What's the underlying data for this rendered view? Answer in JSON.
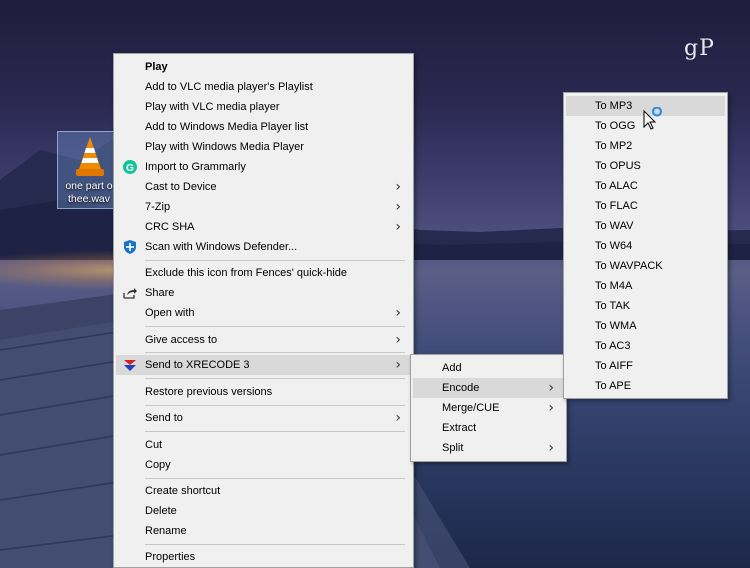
{
  "watermark": "gP",
  "desktop_icon": {
    "label_line1": "one part o",
    "label_line2": "thee.wav"
  },
  "main_menu": {
    "play": "Play",
    "add_vlc_playlist": "Add to VLC media player's Playlist",
    "play_vlc": "Play with VLC media player",
    "add_wmp_list": "Add to Windows Media Player list",
    "play_wmp": "Play with Windows Media Player",
    "import_grammarly": "Import to Grammarly",
    "cast_to_device": "Cast to Device",
    "seven_zip": "7-Zip",
    "crc_sha": "CRC SHA",
    "scan_defender": "Scan with Windows Defender...",
    "exclude_fences": "Exclude this icon from Fences' quick-hide",
    "share": "Share",
    "open_with": "Open with",
    "give_access": "Give access to",
    "send_xrecode": "Send to XRECODE 3",
    "restore_versions": "Restore previous versions",
    "send_to": "Send to",
    "cut": "Cut",
    "copy": "Copy",
    "create_shortcut": "Create shortcut",
    "delete": "Delete",
    "rename": "Rename",
    "properties": "Properties"
  },
  "xrecode_menu": {
    "add": "Add",
    "encode": "Encode",
    "merge_cue": "Merge/CUE",
    "extract": "Extract",
    "split": "Split"
  },
  "encode_menu": {
    "items": [
      "To MP3",
      "To OGG",
      "To MP2",
      "To OPUS",
      "To ALAC",
      "To FLAC",
      "To WAV",
      "To W64",
      "To WAVPACK",
      "To M4A",
      "To TAK",
      "To WMA",
      "To AC3",
      "To AIFF",
      "To APE"
    ]
  },
  "colors": {
    "menu_bg": "#f0f0f0",
    "highlight": "#d9d9d9",
    "grammarly": "#15c39a",
    "vlc_orange": "#f08a00"
  }
}
